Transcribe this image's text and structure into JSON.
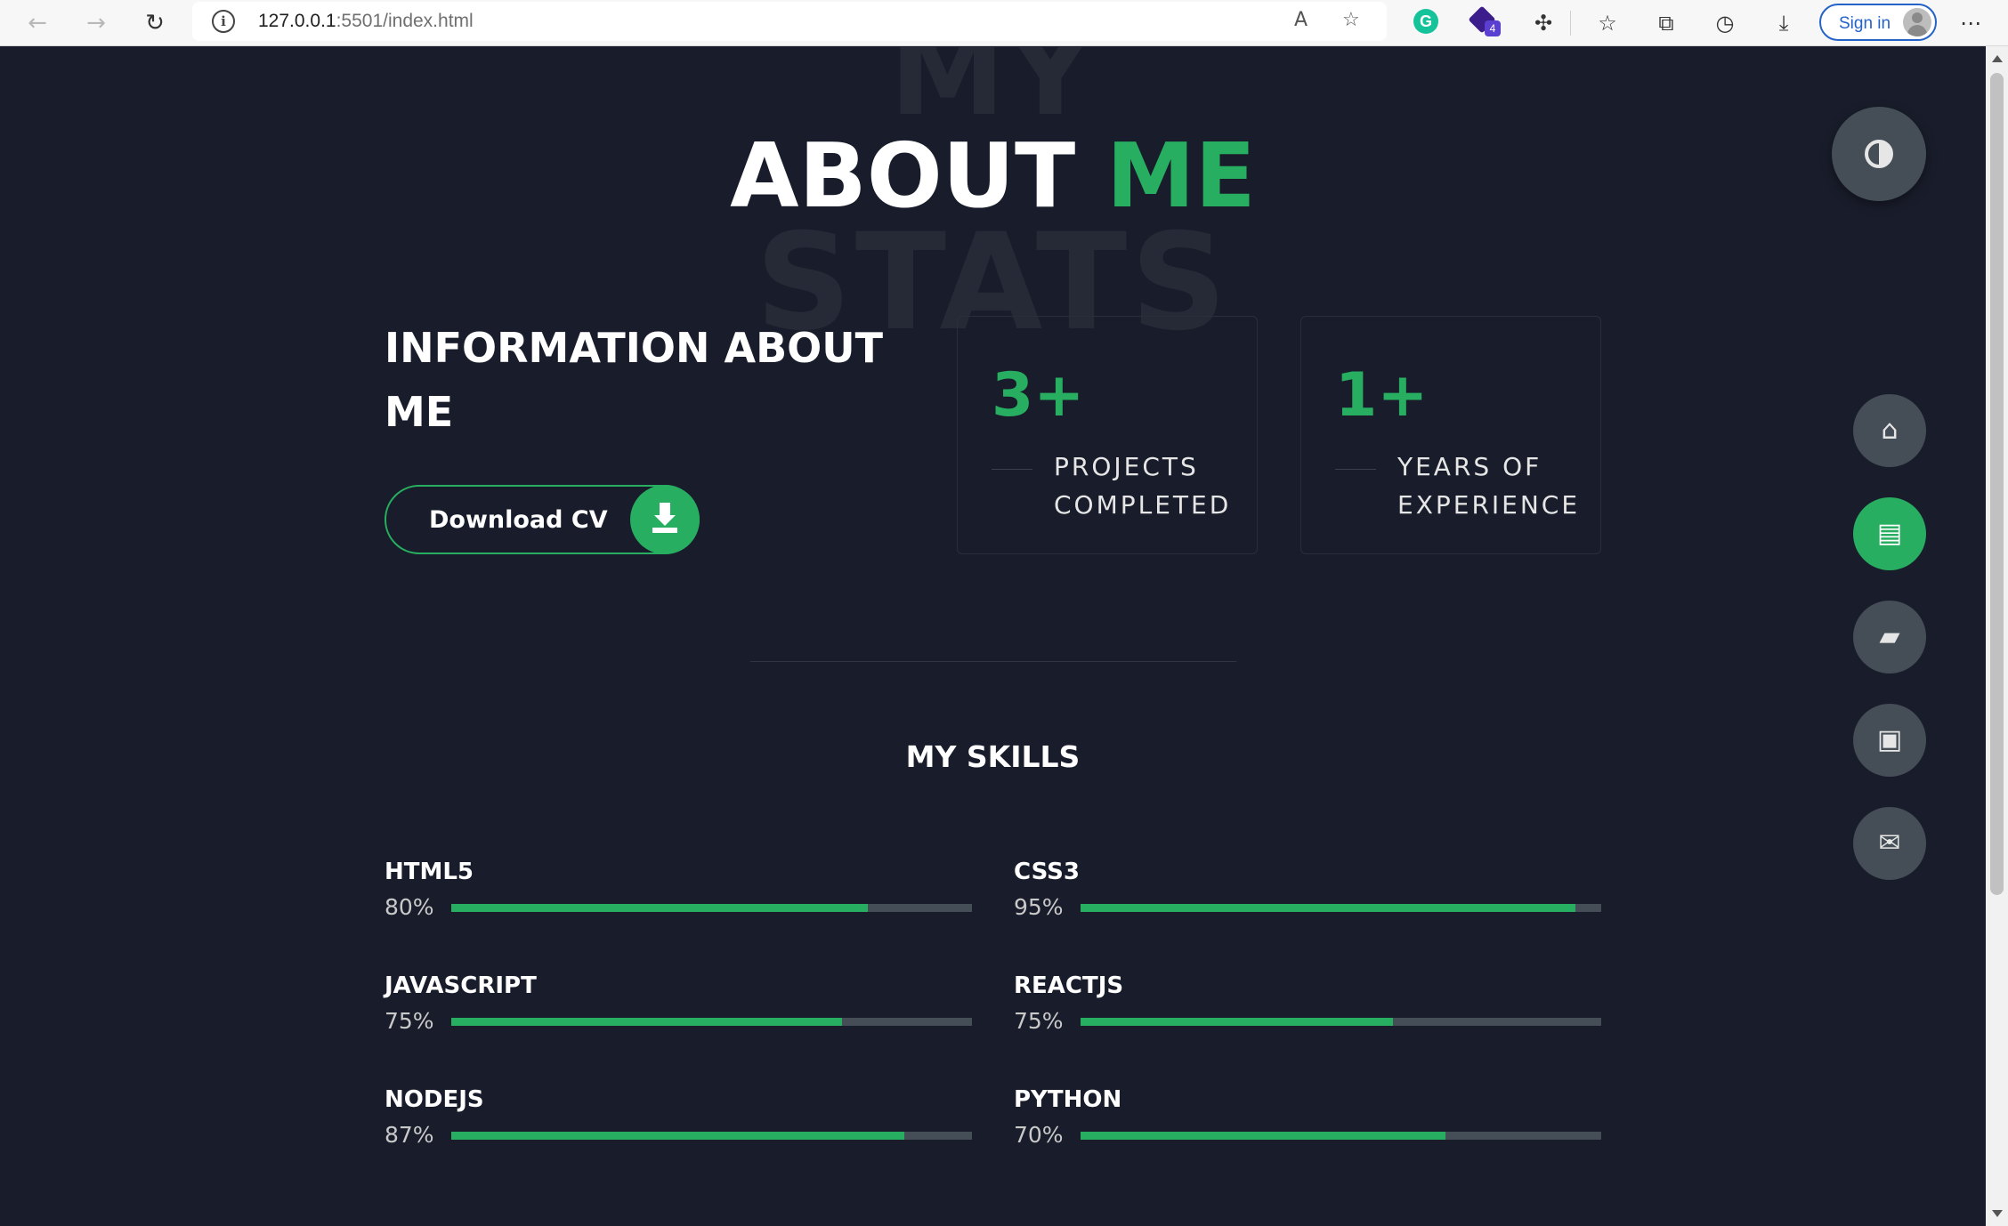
{
  "browser": {
    "url_host": "127.0.0.1",
    "url_path": ":5501/index.html",
    "signin_label": "Sign in",
    "extension_badge": "4"
  },
  "hero": {
    "bg_word_top": "MY",
    "bg_word_bottom": "STATS",
    "title_main": "ABOUT",
    "title_accent": "ME"
  },
  "info": {
    "heading": "INFORMATION ABOUT ME",
    "download_label": "Download CV"
  },
  "stats": [
    {
      "number": "3+",
      "label": "PROJECTS COMPLETED"
    },
    {
      "number": "1+",
      "label": "YEARS OF EXPERIENCE"
    }
  ],
  "skills": {
    "title": "MY SKILLS",
    "items": [
      {
        "name": "HTML5",
        "percent_label": "80%",
        "level": 0.8
      },
      {
        "name": "CSS3",
        "percent_label": "95%",
        "level": 0.95
      },
      {
        "name": "JAVASCRIPT",
        "percent_label": "75%",
        "level": 0.75
      },
      {
        "name": "REACTJS",
        "percent_label": "75%",
        "level": 0.6
      },
      {
        "name": "NODEJS",
        "percent_label": "87%",
        "level": 0.87
      },
      {
        "name": "PYTHON",
        "percent_label": "70%",
        "level": 0.7
      }
    ]
  },
  "side_nav": [
    {
      "icon": "home-icon",
      "active": false
    },
    {
      "icon": "id-card-icon",
      "active": true
    },
    {
      "icon": "folder-open-icon",
      "active": false
    },
    {
      "icon": "briefcase-icon",
      "active": false
    },
    {
      "icon": "envelope-open-icon",
      "active": false
    }
  ],
  "colors": {
    "background": "#191d2b",
    "accent": "#27ae60",
    "button_grey": "#454e56"
  }
}
